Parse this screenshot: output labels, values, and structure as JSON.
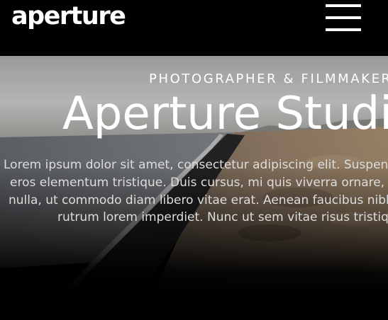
{
  "header": {
    "logo_text": "aperture",
    "menu_icon": "hamburger-menu-icon"
  },
  "hero": {
    "subtitle": "PHOTOGRAPHER & FILMMAKER",
    "title": "Aperture Studio",
    "text_lines": [
      "Lorem ipsum dolor sit amet, consectetur adipiscing elit. Suspendisse",
      "eros elementum tristique. Duis cursus, mi quis viverra ornare, eros",
      "nulla, ut commodo diam libero vitae erat. Aenean faucibus nibh et",
      "rutrum lorem imperdiet. Nunc ut sem vitae risus tristique"
    ],
    "background_image": "coastline-landscape-photo"
  },
  "colors": {
    "background": "#000000",
    "text": "#ffffff",
    "body_text": "#dddddd"
  }
}
